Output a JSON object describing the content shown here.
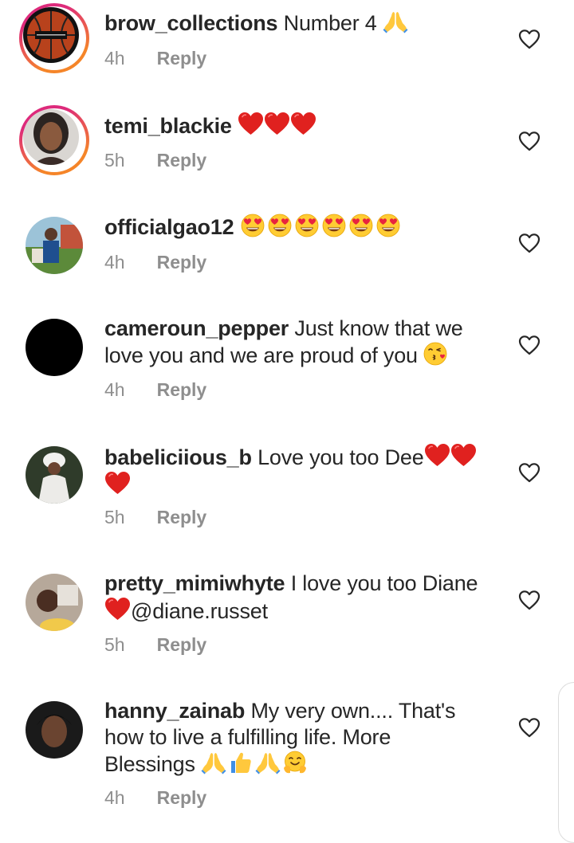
{
  "comments": [
    {
      "username": "brow_collections",
      "text": "Number 4",
      "time": "4h",
      "reply": "Reply",
      "avatar": "basketball-logo"
    },
    {
      "username": "temi_blackie",
      "text": "",
      "time": "5h",
      "reply": "Reply",
      "avatar": "portrait"
    },
    {
      "username": "officialgao12",
      "text": "",
      "time": "4h",
      "reply": "Reply",
      "avatar": "outdoor-photo"
    },
    {
      "username": "cameroun_pepper",
      "text": "Just know that we love you and we are proud of you",
      "time": "4h",
      "reply": "Reply",
      "avatar": "black-circle"
    },
    {
      "username": "babeliciious_b",
      "text": "Love you too Dee",
      "time": "5h",
      "reply": "Reply",
      "avatar": "portrait-headwrap"
    },
    {
      "username": "pretty_mimiwhyte",
      "text": "I love you too Diane",
      "mention": "@diane.russet",
      "time": "5h",
      "reply": "Reply",
      "avatar": "selfie"
    },
    {
      "username": "hanny_zainab",
      "text": "My very own.... That's how to  live a fulfilling life. More Blessings",
      "time": "4h",
      "reply": "Reply",
      "avatar": "portrait-dark"
    }
  ],
  "colors": {
    "text": "#262626",
    "meta": "#8e8e8e",
    "heart_red": "#e0211f",
    "story_ring_start": "#f58529",
    "story_ring_end": "#dd2a7b"
  }
}
